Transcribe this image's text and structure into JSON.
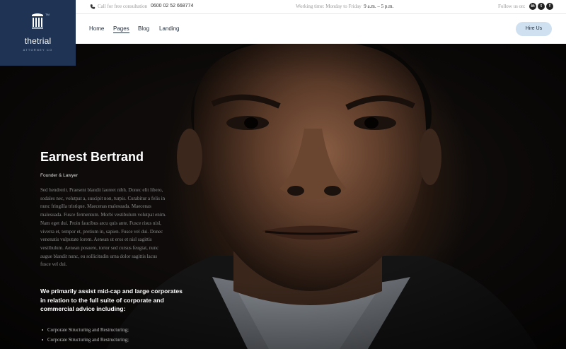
{
  "logo": {
    "name": "thetrial",
    "tagline": "ATTORNEY CO",
    "trademark": "TM"
  },
  "topbar": {
    "consult_text": "Call for free consultation",
    "phone": "0600 02 52 668774",
    "hours_label": "Working time: Monday to Friday",
    "hours_value": "9 a.m. – 5 p.m.",
    "follow_label": "Follow us on:",
    "social": [
      {
        "icon": "linkedin-icon",
        "glyph": "in"
      },
      {
        "icon": "twitter-icon",
        "glyph": "t"
      },
      {
        "icon": "facebook-icon",
        "glyph": "f"
      }
    ]
  },
  "nav": {
    "items": [
      "Home",
      "Pages",
      "Blog",
      "Landing"
    ],
    "active": "Pages",
    "cta": "Hire Us"
  },
  "hero": {
    "name": "Earnest Bertrand",
    "role": "Founder & Lawyer",
    "bio": "Sed hendrerit. Praesent blandit laoreet nibh. Donec elit libero, sodales nec, volutpat a, suscipit non, turpis. Curabitur a felis in nunc fringilla tristique. Maecenas malesuada. Maecenas malesuada. Fusce fermentum. Morbi vestibulum volutpat enim. Nam eget dui. Proin faucibus arcu quis ante. Fusce risus nisl, viverra et, tempor et, pretium in, sapien. Fusce vel dui. Donec venenatis vulputate lorem. Aenean ut eros et nisl sagittis vestibulum. Aenean posuere, tortor sed cursus feugiat, nunc augue blandit nunc, eu sollicitudin urna dolor sagittis lacus fusce vel dui.",
    "lead": "We primarily assist mid-cap and large corporates in relation to the full suite of corporate and commercial advice including:",
    "list": [
      "Corporate Structuring and Restructuring;",
      "Corporate Structuring and Restructuring;"
    ]
  },
  "colors": {
    "brand": "#1f3454",
    "cta_bg": "#cfe0f1",
    "background": "#0d0d0f"
  }
}
